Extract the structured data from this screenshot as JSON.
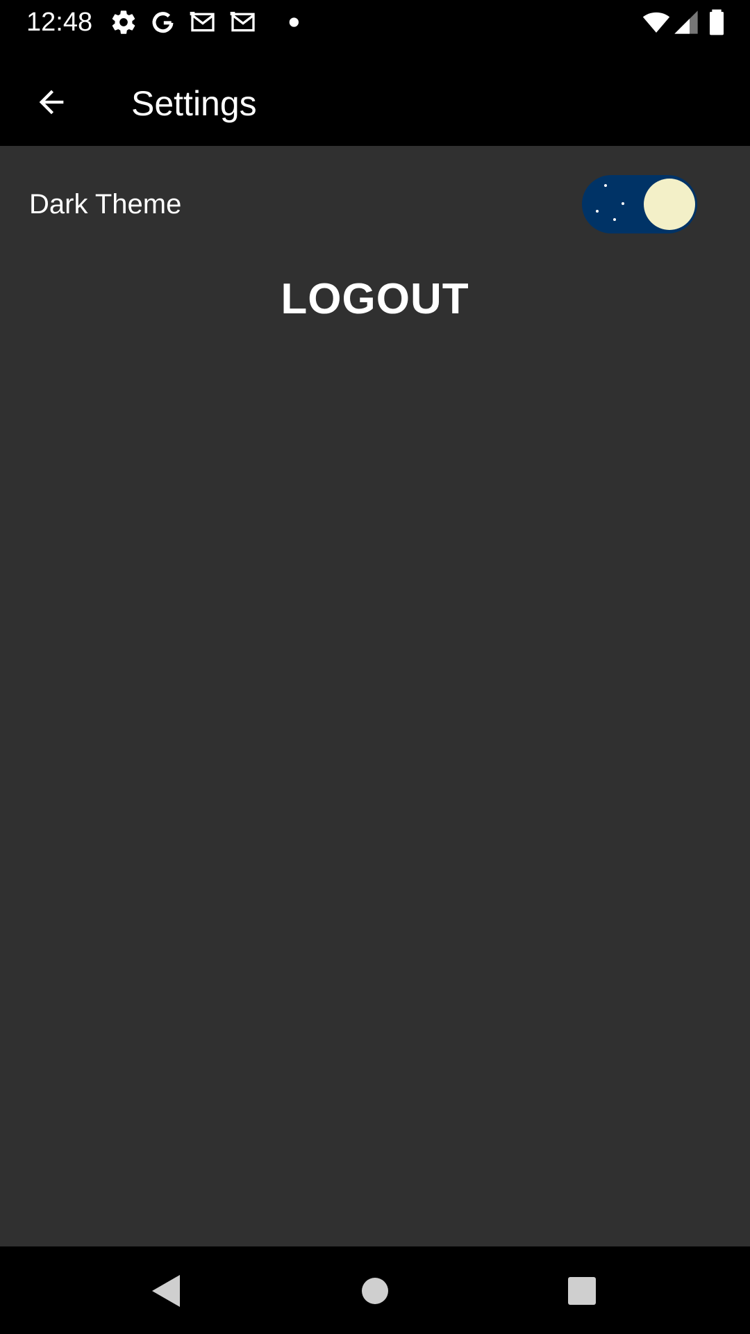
{
  "status_bar": {
    "time": "12:48",
    "left_icons": [
      "gear-icon",
      "google-icon",
      "gmail-icon",
      "gmail-icon",
      "dot-icon"
    ],
    "right_icons": [
      "wifi-icon",
      "signal-icon",
      "battery-icon"
    ]
  },
  "app_bar": {
    "back_icon": "arrow-back-icon",
    "title": "Settings"
  },
  "settings": {
    "dark_theme": {
      "label": "Dark Theme",
      "enabled": true,
      "track_color": "#003366",
      "knob_color": "#f3f0c8"
    },
    "logout_label": "LOGOUT"
  },
  "nav_bar": {
    "buttons": [
      "back-triangle-icon",
      "home-circle-icon",
      "recents-square-icon"
    ]
  },
  "colors": {
    "background": "#303030",
    "bars": "#000000",
    "text": "#ffffff"
  }
}
